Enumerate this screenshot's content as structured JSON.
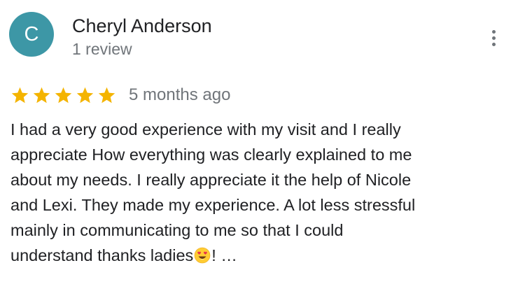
{
  "reviewer": {
    "initial": "C",
    "name": "Cheryl Anderson",
    "review_count": "1 review",
    "avatar_color": "#3d97a6"
  },
  "review": {
    "rating": 5,
    "max_rating": 5,
    "star_color": "#f4b400",
    "date": "5 months ago",
    "text_lines": [
      "I had a very good experience with my visit and I really",
      "appreciate How everything was clearly explained to me",
      "about my needs. I really appreciate it the help of Nicole",
      "and Lexi. They made my experience. A lot less stressful",
      "mainly in communicating to me so that I could"
    ],
    "last_line_before_emoji": "understand thanks ladies",
    "emoji": "smiling-face-with-heart-eyes-icon",
    "last_line_after_emoji": "! …"
  },
  "actions": {
    "more_icon": "more-vertical-icon"
  }
}
